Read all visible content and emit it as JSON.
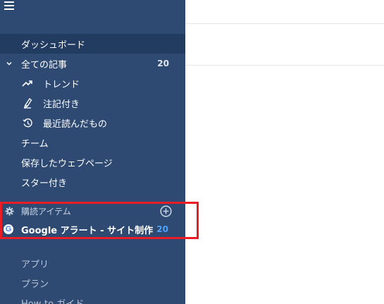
{
  "sidebar": {
    "dashboard": "ダッシュボード",
    "all_articles": {
      "label": "全ての記事",
      "count": "20"
    },
    "trend": "トレンド",
    "annotated": "注記付き",
    "recently_read": "最近読んだもの",
    "team": "チーム",
    "saved_pages": "保存したウェブページ",
    "starred": "スター付き",
    "subscriptions": {
      "header": "購読アイテム"
    },
    "feed": {
      "label": "Google アラート - サイト制作",
      "count": "20"
    },
    "apps": "アプリ",
    "plans": "プラン",
    "howto": "How-to ガイド"
  },
  "colors": {
    "sidebar_bg": "#2e4a73",
    "active_bg": "#223c61",
    "highlight_border": "#ec1c24",
    "count_accent": "#4ea3ff"
  }
}
